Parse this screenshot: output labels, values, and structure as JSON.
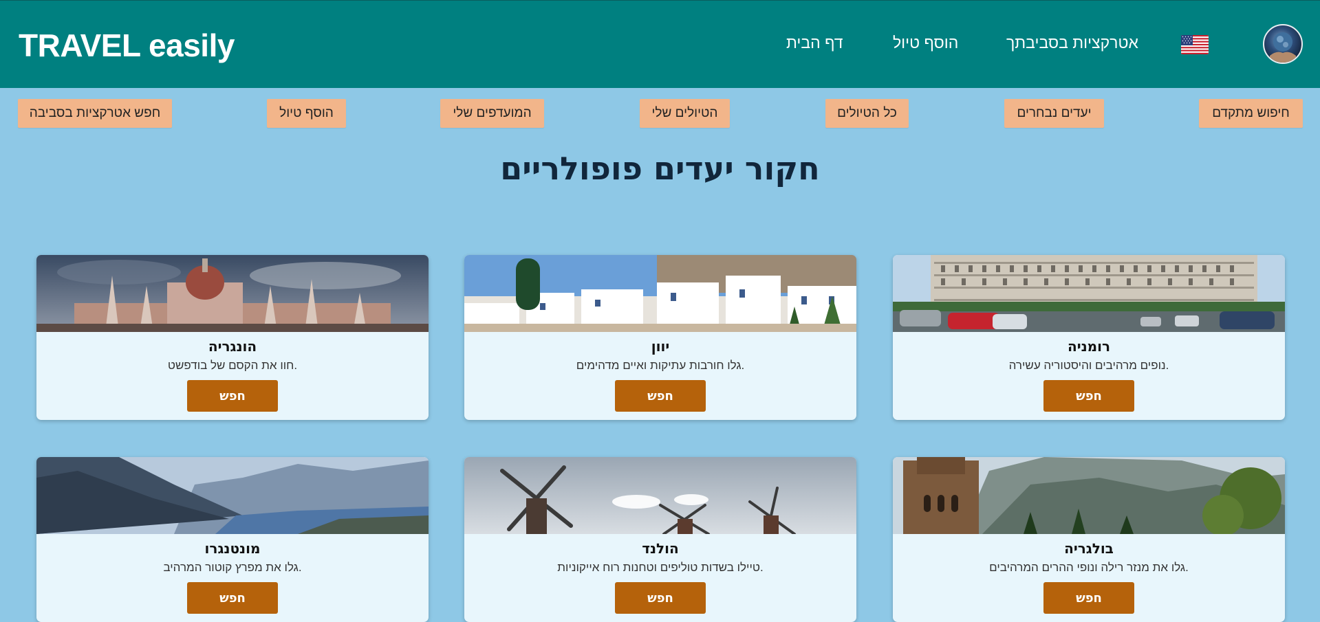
{
  "header": {
    "brand": "TRAVEL easily",
    "nav": {
      "home": "דף הבית",
      "add_trip": "הוסף טיול",
      "attractions": "אטרקציות בסביבתך"
    },
    "language_icon": "us-flag-icon",
    "avatar_icon": "user-avatar",
    "background_color": "#008080"
  },
  "actions": {
    "advanced_search": "חיפוש מתקדם",
    "selected_destinations": "יעדים נבחרים",
    "all_trips": "כל הטיולים",
    "my_trips": "הטיולים שלי",
    "my_favorites": "המועדפים שלי",
    "add_trip": "הוסף טיול",
    "search_attractions": "חפש אטרקציות בסביבה",
    "button_color": "#f2b58a"
  },
  "page_title": "חקור יעדים פופולריים",
  "destinations": [
    {
      "name": "רומניה",
      "description": "נופים מרהיבים והיסטוריה עשירה.",
      "button": "חפש"
    },
    {
      "name": "יוון",
      "description": "גלו חורבות עתיקות ואיים מדהימים.",
      "button": "חפש"
    },
    {
      "name": "הונגריה",
      "description": "חוו את הקסם של בודפשט.",
      "button": "חפש"
    },
    {
      "name": "בולגריה",
      "description": "גלו את מנזר רילה ונופי ההרים המרהיבים.",
      "button": "חפש"
    },
    {
      "name": "הולנד",
      "description": "טיילו בשדות טוליפים וטחנות רוח אייקוניות.",
      "button": "חפש"
    },
    {
      "name": "מונטנגרו",
      "description": "גלו את מפרץ קוטור המרהיב.",
      "button": "חפש"
    }
  ],
  "colors": {
    "page_background": "#8ec8e6",
    "card_background": "#e8f6fc",
    "search_button": "#b5620b"
  }
}
